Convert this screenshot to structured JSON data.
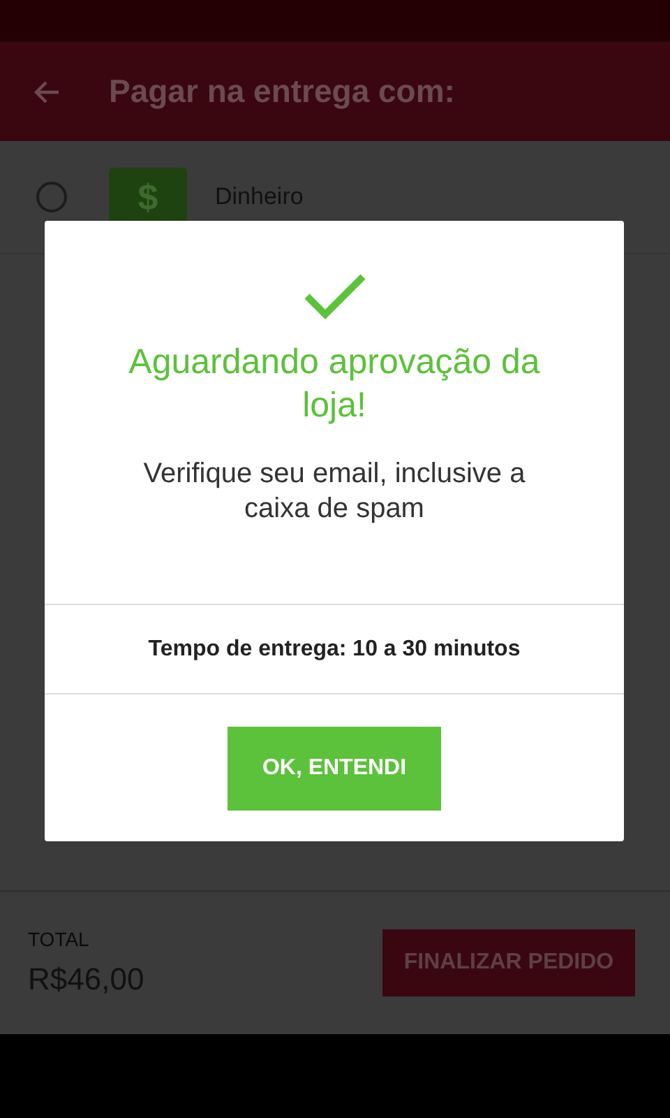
{
  "app_bar": {
    "title": "Pagar na entrega com:"
  },
  "payment_options": [
    {
      "label": "Dinheiro",
      "symbol": "$",
      "selected": false
    }
  ],
  "footer": {
    "total_label": "TOTAL",
    "total_value": "R$46,00",
    "button": "FINALIZAR PEDIDO"
  },
  "dialog": {
    "title": "Aguardando aprovação da loja!",
    "message": "Verifique seu email, inclusive a caixa de spam",
    "delivery_time": "Tempo de entrega: 10 a 30 minutos",
    "button": "OK, ENTENDI"
  }
}
